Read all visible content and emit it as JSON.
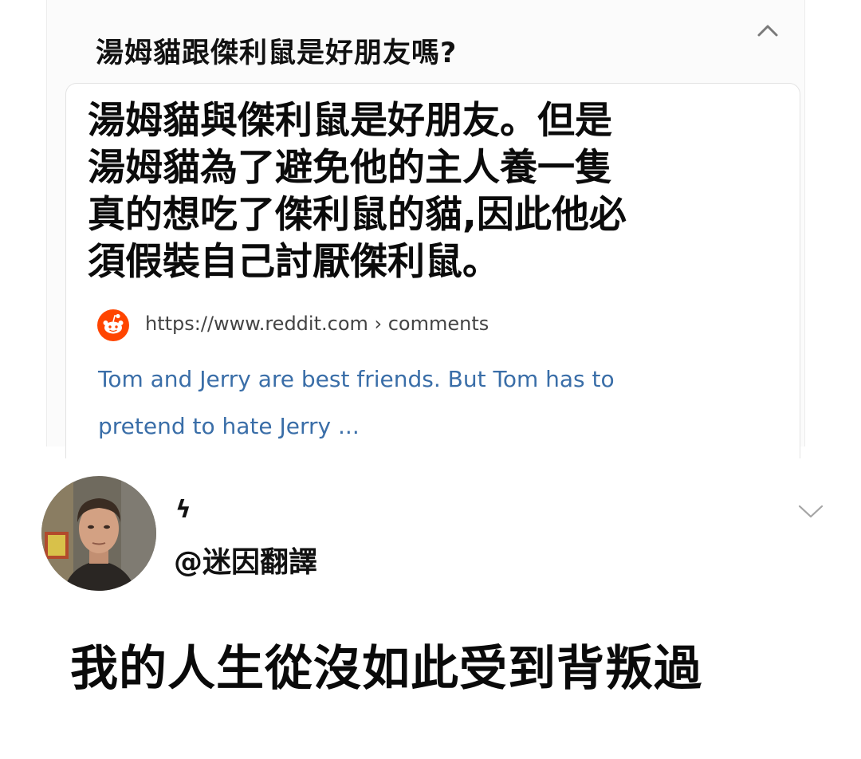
{
  "search_result": {
    "question": "湯姆貓跟傑利鼠是好朋友嗎?",
    "answer_lines": [
      "湯姆貓與傑利鼠是好朋友。但是",
      "湯姆貓為了避免他的主人養一隻",
      "真的想吃了傑利鼠的貓,因此他必",
      "須假裝自己討厭傑利鼠。"
    ],
    "source_url": "https://www.reddit.com › comments",
    "snippet_lines": [
      "Tom and Jerry are best friends. But Tom has to",
      "pretend to hate Jerry ..."
    ],
    "collapse_icon": "chevron-up-icon",
    "source_icon": "reddit-icon",
    "source_icon_color": "#ff4500",
    "snippet_color": "#3a6ea8"
  },
  "tweet": {
    "display_name": "ϟ",
    "handle": "@迷因翻譯",
    "text": "我的人生從沒如此受到背叛過",
    "avatar": "avatar-photo",
    "more_icon": "chevron-down-icon"
  }
}
